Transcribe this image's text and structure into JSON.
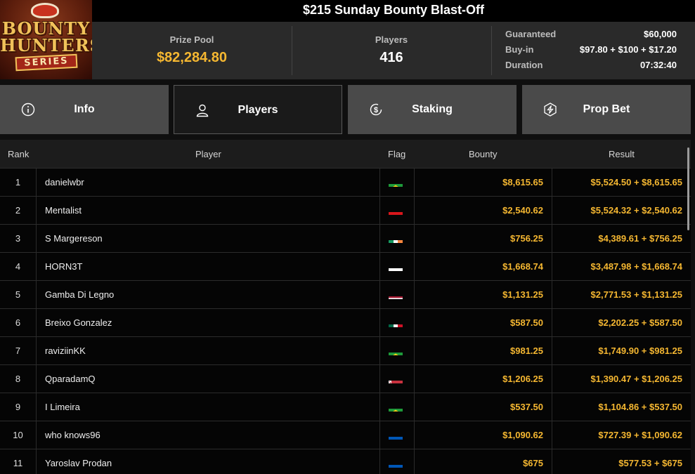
{
  "logo": {
    "line1": "BOUNTY",
    "line2": "HUNTERS",
    "line3": "SERIES"
  },
  "title": "$215 Sunday Bounty Blast-Off",
  "stats": {
    "prize_pool_label": "Prize Pool",
    "prize_pool_value": "$82,284.80",
    "players_label": "Players",
    "players_value": "416",
    "guaranteed_label": "Guaranteed",
    "guaranteed_value": "$60,000",
    "buyin_label": "Buy-in",
    "buyin_value": "$97.80 + $100 + $17.20",
    "duration_label": "Duration",
    "duration_value": "07:32:40"
  },
  "tabs": [
    {
      "label": "Info",
      "icon": "info-icon",
      "active": false
    },
    {
      "label": "Players",
      "icon": "user-icon",
      "active": true
    },
    {
      "label": "Staking",
      "icon": "dollar-coin-icon",
      "active": false
    },
    {
      "label": "Prop Bet",
      "icon": "lightning-icon",
      "active": false
    }
  ],
  "table": {
    "headers": {
      "rank": "Rank",
      "player": "Player",
      "flag": "Flag",
      "bounty": "Bounty",
      "result": "Result"
    },
    "rows": [
      {
        "rank": "1",
        "player": "danielwbr",
        "flag": "brazil",
        "bounty": "$8,615.65",
        "result": "$5,524.50 + $8,615.65"
      },
      {
        "rank": "2",
        "player": "Mentalist",
        "flag": "indonesia",
        "bounty": "$2,540.62",
        "result": "$5,524.32 + $2,540.62"
      },
      {
        "rank": "3",
        "player": "S Margereson",
        "flag": "ireland",
        "bounty": "$756.25",
        "result": "$4,389.61 + $756.25"
      },
      {
        "rank": "4",
        "player": "HORN3T",
        "flag": "poland",
        "bounty": "$1,668.74",
        "result": "$3,487.98 + $1,668.74"
      },
      {
        "rank": "5",
        "player": "Gamba Di Legno",
        "flag": "thailand",
        "bounty": "$1,131.25",
        "result": "$2,771.53 + $1,131.25"
      },
      {
        "rank": "6",
        "player": "Breixo Gonzalez",
        "flag": "mexico",
        "bounty": "$587.50",
        "result": "$2,202.25 + $587.50"
      },
      {
        "rank": "7",
        "player": "raviziinKK",
        "flag": "brazil",
        "bounty": "$981.25",
        "result": "$1,749.90 + $981.25"
      },
      {
        "rank": "8",
        "player": "QparadamQ",
        "flag": "belarus",
        "bounty": "$1,206.25",
        "result": "$1,390.47 + $1,206.25"
      },
      {
        "rank": "9",
        "player": "I Limeira",
        "flag": "brazil",
        "bounty": "$537.50",
        "result": "$1,104.86 + $537.50"
      },
      {
        "rank": "10",
        "player": "who knows96",
        "flag": "ukraine",
        "bounty": "$1,090.62",
        "result": "$727.39 + $1,090.62"
      },
      {
        "rank": "11",
        "player": "Yaroslav Prodan",
        "flag": "ukraine",
        "bounty": "$675",
        "result": "$577.53 + $675"
      }
    ]
  },
  "colors": {
    "accent": "#f5b731",
    "tab_bg": "#4a4a4a",
    "tab_active_bg": "#1a1a1a"
  }
}
